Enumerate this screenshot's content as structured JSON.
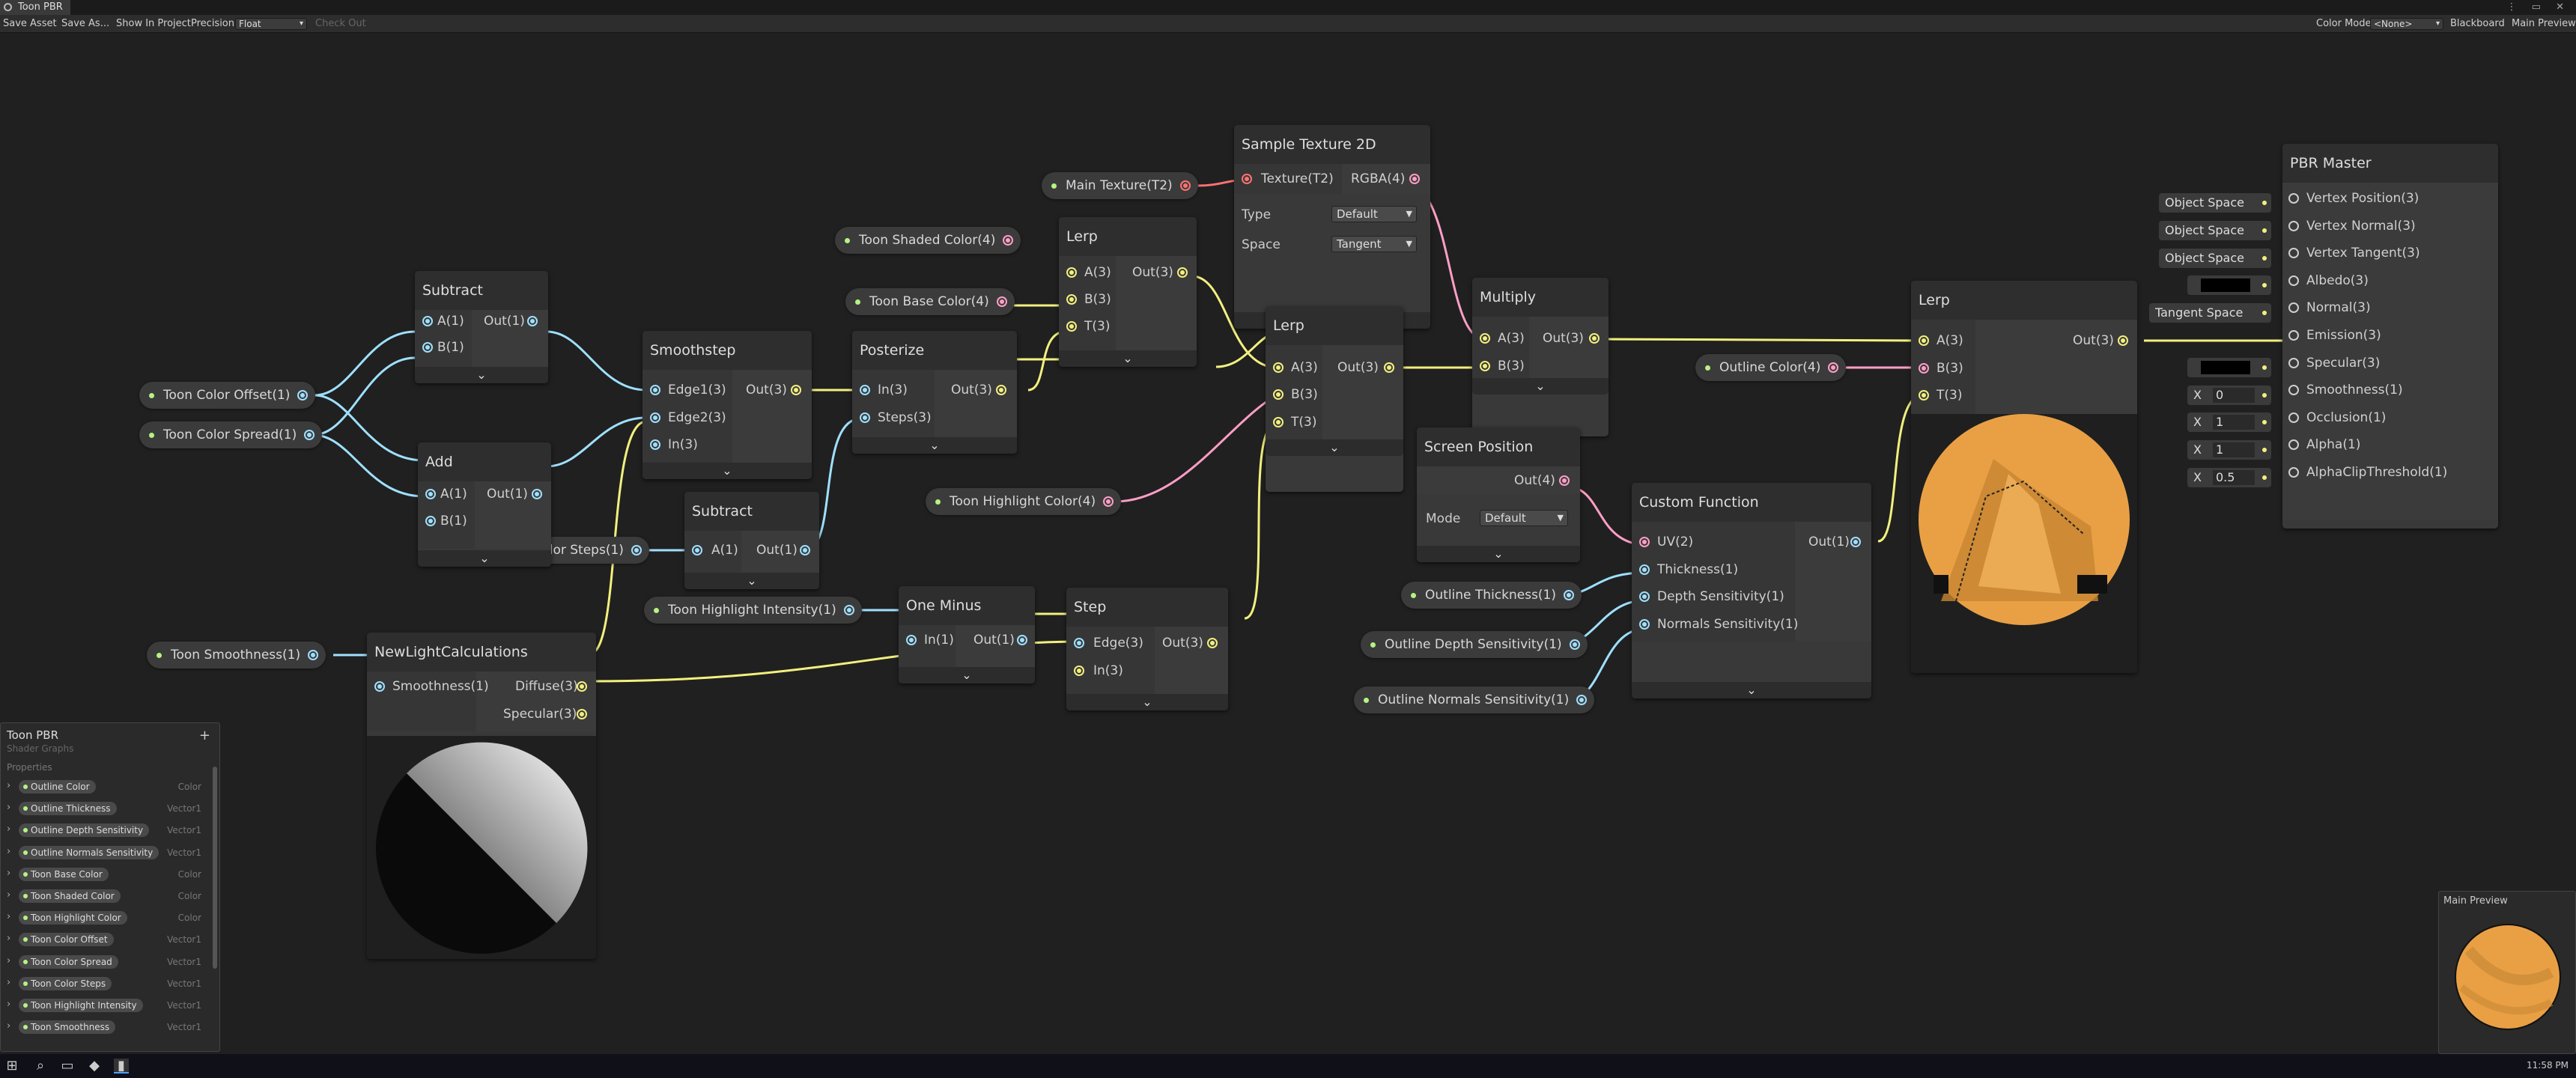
{
  "window": {
    "title": "Toon PBR",
    "controls": "⋮ ▭ ✕"
  },
  "toolbar": {
    "save_asset": "Save Asset",
    "save_as": "Save As...",
    "show_in_project": "Show In Project",
    "precision_label": "Precision",
    "precision_value": "Float",
    "check_out": "Check Out",
    "color_mode_label": "Color Mode",
    "color_mode_value": "<None>",
    "blackboard": "Blackboard",
    "main_preview": "Main Preview"
  },
  "nodes": {
    "subtract1": {
      "title": "Subtract",
      "in_a": "A(1)",
      "in_b": "B(1)",
      "out": "Out(1)"
    },
    "add": {
      "title": "Add",
      "in_a": "A(1)",
      "in_b": "B(1)",
      "out": "Out(1)"
    },
    "smoothstep": {
      "title": "Smoothstep",
      "in1": "Edge1(3)",
      "in2": "Edge2(3)",
      "in3": "In(3)",
      "out": "Out(3)"
    },
    "subtract2": {
      "title": "Subtract",
      "in_a": "A(1)",
      "out": "Out(1)"
    },
    "posterize": {
      "title": "Posterize",
      "in1": "In(3)",
      "in2": "Steps(3)",
      "out": "Out(3)"
    },
    "lerp1": {
      "title": "Lerp",
      "in_a": "A(3)",
      "in_b": "B(3)",
      "in_t": "T(3)",
      "out": "Out(3)"
    },
    "sample_texture": {
      "title": "Sample Texture 2D",
      "in": "Texture(T2)",
      "out": "RGBA(4)",
      "type_label": "Type",
      "type_value": "Default",
      "space_label": "Space",
      "space_value": "Tangent"
    },
    "lerp2": {
      "title": "Lerp",
      "in_a": "A(3)",
      "in_b": "B(3)",
      "in_t": "T(3)",
      "out": "Out(3)"
    },
    "multiply": {
      "title": "Multiply",
      "in_a": "A(3)",
      "in_b": "B(3)",
      "out": "Out(3)"
    },
    "screen_position": {
      "title": "Screen Position",
      "out": "Out(4)",
      "mode_label": "Mode",
      "mode_value": "Default"
    },
    "custom_function": {
      "title": "Custom Function",
      "in1": "UV(2)",
      "in2": "Thickness(1)",
      "in3": "Depth Sensitivity(1)",
      "in4": "Normals Sensitivity(1)",
      "out": "Out(1)"
    },
    "lerp3": {
      "title": "Lerp",
      "in_a": "A(3)",
      "in_b": "B(3)",
      "in_t": "T(3)",
      "out": "Out(3)"
    },
    "one_minus": {
      "title": "One Minus",
      "in": "In(1)",
      "out": "Out(1)"
    },
    "step": {
      "title": "Step",
      "in1": "Edge(3)",
      "in2": "In(3)",
      "out": "Out(3)"
    },
    "light_calc": {
      "title": "NewLightCalculations",
      "in": "Smoothness(1)",
      "out1": "Diffuse(3)",
      "out2": "Specular(3)"
    },
    "pbr_master": {
      "title": "PBR Master",
      "inputs": [
        "Vertex Position(3)",
        "Vertex Normal(3)",
        "Vertex Tangent(3)",
        "Albedo(3)",
        "Normal(3)",
        "Emission(3)",
        "Specular(3)",
        "Smoothness(1)",
        "Occlusion(1)",
        "Alpha(1)",
        "AlphaClipThreshold(1)"
      ],
      "slot_vertex_position": "Object Space",
      "slot_vertex_normal": "Object Space",
      "slot_vertex_tangent": "Object Space",
      "slot_normal": "Tangent Space",
      "x_label": "X",
      "smoothness_value": "0",
      "occlusion_value": "1",
      "alpha_value": "1",
      "alpha_clip_value": "0.5"
    }
  },
  "properties": {
    "toon_shaded_color": "Toon Shaded Color(4)",
    "toon_base_color": "Toon Base Color(4)",
    "main_texture": "Main Texture(T2)",
    "toon_color_offset": "Toon Color Offset(1)",
    "toon_color_spread": "Toon Color Spread(1)",
    "toon_color_steps": "Toon Color Steps(1)",
    "toon_highlight_color": "Toon Highlight Color(4)",
    "toon_highlight_intensity": "Toon Highlight Intensity(1)",
    "toon_smoothness": "Toon Smoothness(1)",
    "outline_color": "Outline Color(4)",
    "outline_thickness": "Outline Thickness(1)",
    "outline_depth_sensitivity": "Outline Depth Sensitivity(1)",
    "outline_normals_sensitivity": "Outline Normals Sensitivity(1)"
  },
  "blackboard": {
    "title": "Toon PBR",
    "subtitle": "Shader Graphs",
    "add": "+",
    "section": "Properties",
    "items": [
      {
        "name": "Outline Color",
        "type": "Color"
      },
      {
        "name": "Outline Thickness",
        "type": "Vector1"
      },
      {
        "name": "Outline Depth Sensitivity",
        "type": "Vector1"
      },
      {
        "name": "Outline Normals Sensitivity",
        "type": "Vector1"
      },
      {
        "name": "Toon Base Color",
        "type": "Color"
      },
      {
        "name": "Toon Shaded Color",
        "type": "Color"
      },
      {
        "name": "Toon Highlight Color",
        "type": "Color"
      },
      {
        "name": "Toon Color Offset",
        "type": "Vector1"
      },
      {
        "name": "Toon Color Spread",
        "type": "Vector1"
      },
      {
        "name": "Toon Color Steps",
        "type": "Vector1"
      },
      {
        "name": "Toon Highlight Intensity",
        "type": "Vector1"
      },
      {
        "name": "Toon Smoothness",
        "type": "Vector1"
      }
    ]
  },
  "main_preview": {
    "title": "Main Preview"
  },
  "taskbar": {
    "clock": "11:58 PM"
  },
  "colors": {
    "vector1": "#9fe0ff",
    "vector3": "#f2f07e",
    "vector4": "#ff9ec7",
    "texture": "#ff7272",
    "albedo": "#e9a045"
  }
}
